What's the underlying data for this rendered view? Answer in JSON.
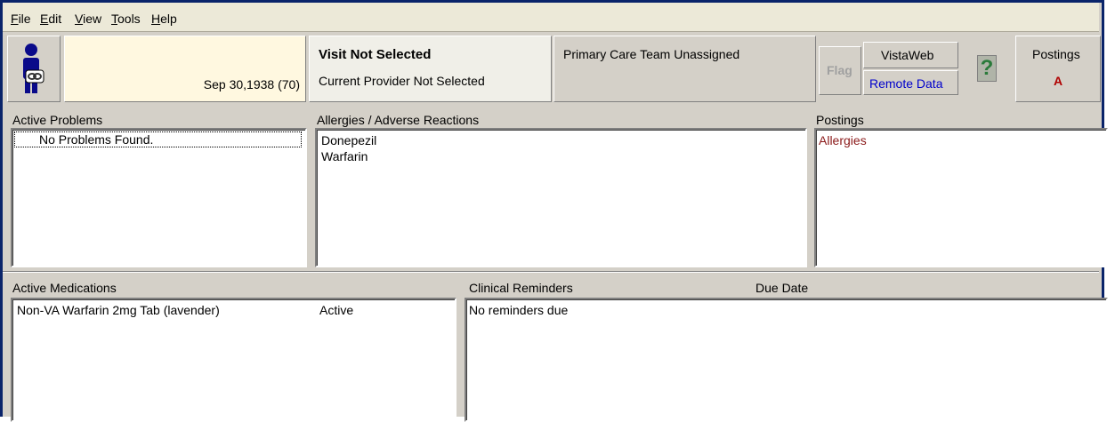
{
  "menu": {
    "items": [
      {
        "key": "F",
        "rest": "ile"
      },
      {
        "key": "E",
        "rest": "dit"
      },
      {
        "key": "V",
        "rest": "iew"
      },
      {
        "key": "T",
        "rest": "ools"
      },
      {
        "key": "H",
        "rest": "elp"
      }
    ]
  },
  "patient": {
    "dob": "Sep 30,1938 (70)"
  },
  "visit": {
    "title": "Visit Not Selected",
    "provider": "Current Provider Not Selected"
  },
  "primary_care": "Primary Care Team Unassigned",
  "toolbar": {
    "flag_label": "Flag",
    "vistaweb_label": "VistaWeb",
    "remote_data_label": "Remote Data",
    "help_glyph": "?",
    "postings_label": "Postings",
    "postings_code": "A"
  },
  "problems": {
    "title": "Active Problems",
    "items": [
      "No Problems Found."
    ]
  },
  "allergies": {
    "title": "Allergies / Adverse Reactions",
    "items": [
      "Donepezil",
      "Warfarin"
    ]
  },
  "postings": {
    "title": "Postings",
    "items": [
      "Allergies"
    ]
  },
  "medications": {
    "title": "Active Medications",
    "items": [
      {
        "name": "Non-VA  Warfarin 2mg Tab (lavender)",
        "status": "Active"
      }
    ]
  },
  "reminders": {
    "title": "Clinical Reminders",
    "due_header": "Due Date",
    "items": [
      "No reminders due"
    ]
  },
  "colors": {
    "posting_item": "#8b1a1a",
    "remote_data": "#0000cc",
    "postings_code": "#b00000",
    "flag_disabled": "#a0a0a0"
  }
}
